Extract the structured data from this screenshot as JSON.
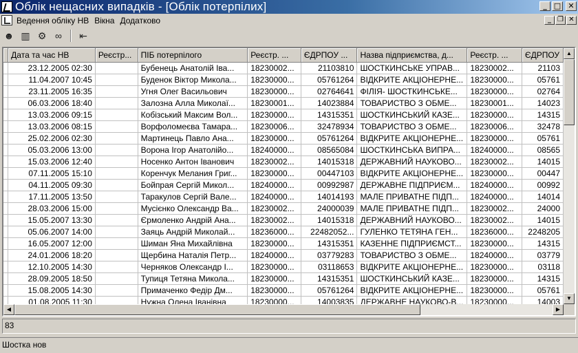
{
  "window": {
    "title": "Облік нещасних випадків - [Облік потерпілих]",
    "controls": {
      "minimize": "_",
      "maximize": "□",
      "close": "✕"
    }
  },
  "menu": {
    "items": [
      "Ведення обліку НВ",
      "Вікна",
      "Додатково"
    ],
    "mdi_controls": {
      "minimize": "_",
      "restore": "❐",
      "close": "✕"
    }
  },
  "toolbar": {
    "icons": [
      "face-icon",
      "book-icon",
      "gear-person-icon",
      "binoculars-icon",
      "exit-door-icon"
    ]
  },
  "grid": {
    "columns": [
      "Дата та час НВ",
      "Реєстр...",
      "ПІБ потерпілого",
      "Реєстр. ...",
      "ЄДРПОУ ...",
      "Назва підприємства, д...",
      "Реєстр. ...",
      "ЄДРПОУ"
    ],
    "rows": [
      [
        "23.12.2005 02:30",
        "",
        "Бубенець Анатолій Іва...",
        "18230002...",
        "21103810",
        "ШОСТКИНСЬКЕ УПРАВ...",
        "18230002...",
        "21103"
      ],
      [
        "11.04.2007 10:45",
        "",
        "Буденок Віктор Микола...",
        "18230000...",
        "05761264",
        "ВІДКРИТЕ АКЦІОНЕРНЕ...",
        "18230000...",
        "05761"
      ],
      [
        "23.11.2005 16:35",
        "",
        "Угня Олег Васильович",
        "18230000...",
        "02764641",
        "ФІЛІЯ- ШОСТКИНСЬКЕ...",
        "18230000...",
        "02764"
      ],
      [
        "06.03.2006 18:40",
        "",
        "Залозна Алла Миколаї...",
        "18230001...",
        "14023884",
        "ТОВАРИСТВО З ОБМЕ...",
        "18230001...",
        "14023"
      ],
      [
        "13.03.2006 09:15",
        "",
        "Кобізський Максим Вол...",
        "18230000...",
        "14315351",
        "ШОСТКИНСЬКИЙ КАЗЕ...",
        "18230000...",
        "14315"
      ],
      [
        "13.03.2006 08:15",
        "",
        "Ворфоломеєва Тамара...",
        "18230006...",
        "32478934",
        "ТОВАРИСТВО З ОБМЕ...",
        "18230006...",
        "32478"
      ],
      [
        "25.02.2006 02:30",
        "",
        "Мартинець Павло Ана...",
        "18230000...",
        "05761264",
        "ВІДКРИТЕ АКЦІОНЕРНЕ...",
        "18230000...",
        "05761"
      ],
      [
        "05.03.2006 13:00",
        "",
        "Ворона Ігор Анатолійо...",
        "18240000...",
        "08565084",
        "ШОСТКИНСЬКА ВИПРА...",
        "18240000...",
        "08565"
      ],
      [
        "15.03.2006 12:40",
        "",
        "Носенко Антон Іванович",
        "18230002...",
        "14015318",
        "ДЕРЖАВНИЙ НАУКОВО...",
        "18230002...",
        "14015"
      ],
      [
        "07.11.2005 15:10",
        "",
        "Коренчук Мелания Григ...",
        "18230000...",
        "00447103",
        "ВІДКРИТЕ АКЦІОНЕРНЕ...",
        "18230000...",
        "00447"
      ],
      [
        "04.11.2005 09:30",
        "",
        "Бойпрая Сергій Микол...",
        "18240000...",
        "00992987",
        "ДЕРЖАВНЕ  ПІДПРИЄМ...",
        "18240000...",
        "00992"
      ],
      [
        "17.11.2005 13:50",
        "",
        "Таракулов Сергій Вале...",
        "18240000...",
        "14014193",
        "МАЛЕ ПРИВАТНЕ ПІДП...",
        "18240000...",
        "14014"
      ],
      [
        "28.03.2006 15:00",
        "",
        "Мусієнко Олександр Ва...",
        "18230002...",
        "24000039",
        "МАЛЕ ПРИВАТНЕ ПІДП...",
        "18230002...",
        "24000"
      ],
      [
        "15.05.2007 13:30",
        "",
        "Єрмоленко Андрій Ана...",
        "18230002...",
        "14015318",
        "ДЕРЖАВНИЙ НАУКОВО...",
        "18230002...",
        "14015"
      ],
      [
        "05.06.2007 14:00",
        "",
        "Заяць Андрій Миколай...",
        "18236000...",
        "22482052...",
        "ГУЛЕНКО ТЕТЯНА ГЕН...",
        "18236000...",
        "2248205"
      ],
      [
        "16.05.2007 12:00",
        "",
        "Шиман Яна Михайлівна",
        "18230000...",
        "14315351",
        "КАЗЕННЕ ПІДПРИЄМСТ...",
        "18230000...",
        "14315"
      ],
      [
        "24.01.2006 18:20",
        "",
        "Щербина Наталія Петр...",
        "18240000...",
        "03779283",
        "ТОВАРИСТВО З ОБМЕ...",
        "18240000...",
        "03779"
      ],
      [
        "12.10.2005 14:30",
        "",
        "Черняков Олександр І...",
        "18230000...",
        "03118653",
        "ВІДКРИТЕ АКЦІОНЕРНЕ...",
        "18230000...",
        "03118"
      ],
      [
        "28.09.2005 18:50",
        "",
        "Тупиця Тетяна Микола...",
        "18230000...",
        "14315351",
        "ШОСТКИНСЬКИЙ КАЗЕ...",
        "18230000...",
        "14315"
      ],
      [
        "15.08.2005 14:30",
        "",
        "Примаченко Федір Дм...",
        "18230000...",
        "05761264",
        "ВІДКРИТЕ АКЦІОНЕРНЕ...",
        "18230000...",
        "05761"
      ],
      [
        "01.08.2005 11:30",
        "",
        "Нужна Олена Іванівна",
        "18230000...",
        "14003835",
        "ДЕРЖАВНЕ НАУКОВО-В...",
        "18230000...",
        "14003"
      ]
    ]
  },
  "record_count": "83",
  "status": "Шостка нов"
}
